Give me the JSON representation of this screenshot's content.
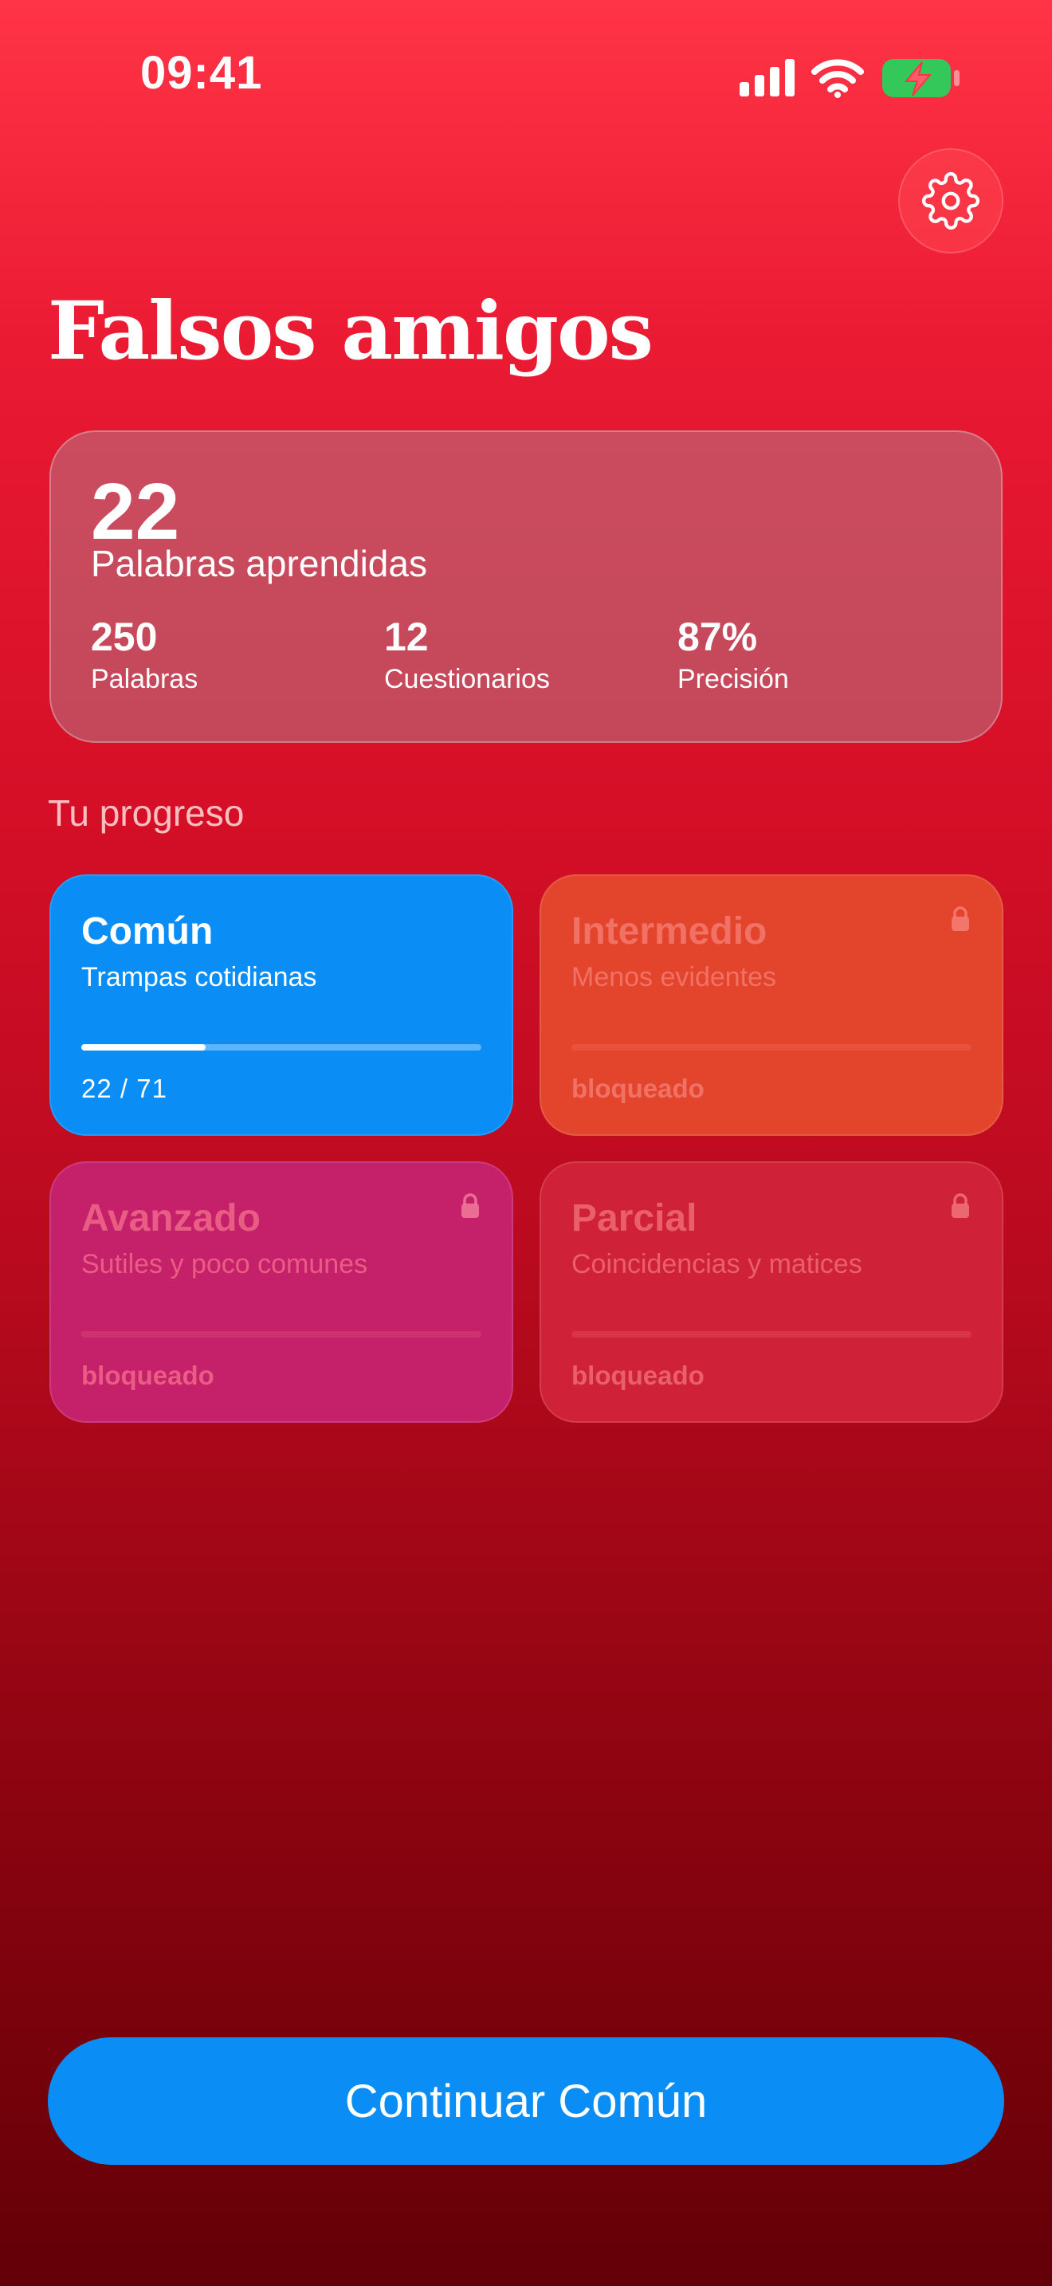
{
  "status_bar": {
    "time": "09:41",
    "icons": [
      "signal-icon",
      "wifi-icon",
      "battery-charging-icon"
    ],
    "battery_color": "#34c759"
  },
  "header": {
    "title": "Falsos amigos",
    "settings_icon": "gear-icon"
  },
  "stats": {
    "learned_count": "22",
    "learned_label": "Palabras aprendidas",
    "items": [
      {
        "value": "250",
        "label": "Palabras"
      },
      {
        "value": "12",
        "label": "Cuestionarios"
      },
      {
        "value": "87%",
        "label": "Precisión"
      }
    ]
  },
  "progress_section": {
    "label": "Tu progreso",
    "levels": [
      {
        "title": "Común",
        "subtitle": "Trampas cotidianas",
        "footer": "22 / 71",
        "progress": 0.31,
        "locked": false,
        "color": "#0a8ef6"
      },
      {
        "title": "Intermedio",
        "subtitle": "Menos evidentes",
        "footer": "bloqueado",
        "progress": 0,
        "locked": true,
        "color": "#e2452c"
      },
      {
        "title": "Avanzado",
        "subtitle": "Sutiles y poco comunes",
        "footer": "bloqueado",
        "progress": 0,
        "locked": true,
        "color": "#c5206a"
      },
      {
        "title": "Parcial",
        "subtitle": "Coincidencias y matices",
        "footer": "bloqueado",
        "progress": 0,
        "locked": true,
        "color": "#cf2137"
      }
    ]
  },
  "cta": {
    "label": "Continuar Común"
  },
  "colors": {
    "accent": "#0a8ef6",
    "background_top": "#ff3446",
    "background_bottom": "#630007"
  }
}
